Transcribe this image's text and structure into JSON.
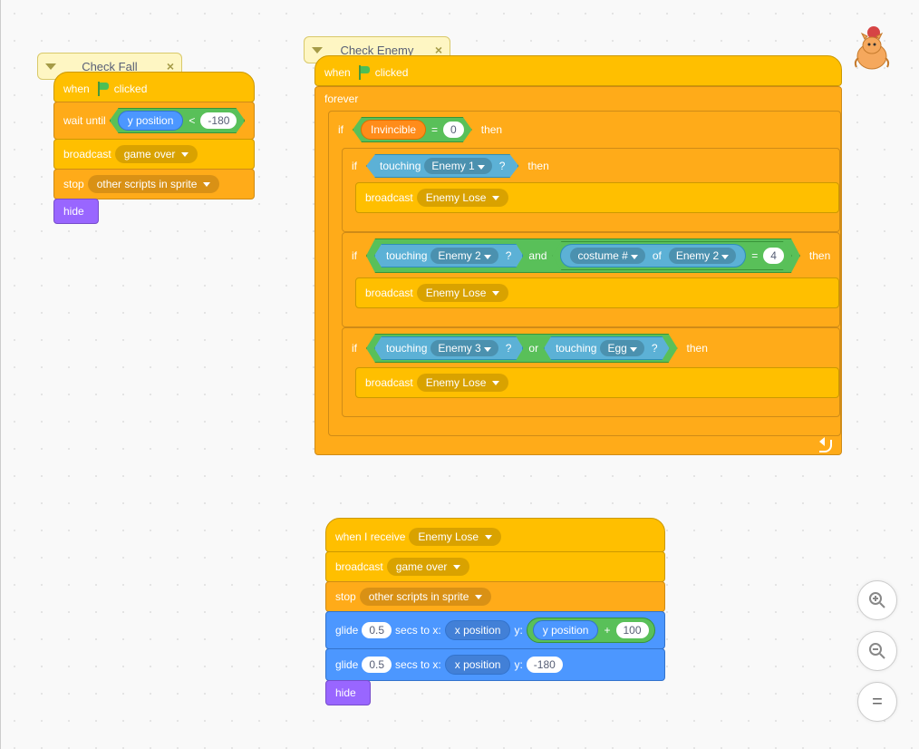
{
  "comments": {
    "checkFall": "Check Fall",
    "checkEnemy": "Check Enemy"
  },
  "common": {
    "when": "when",
    "clicked": "clicked",
    "waitUntil": "wait until",
    "broadcast": "broadcast",
    "stop": "stop",
    "hide": "hide",
    "forever": "forever",
    "if": "if",
    "then": "then",
    "and": "and",
    "or": "or",
    "of": "of",
    "touching": "touching",
    "whenIReceive": "when I receive",
    "glide": "glide",
    "secsToX": "secs to x:",
    "y": "y:",
    "lt": "<",
    "eq": "=",
    "plus": "+",
    "q": "?"
  },
  "fall": {
    "yposition": "y position",
    "ylimit": "-180",
    "gameOver": "game over",
    "otherScripts": "other scripts in sprite"
  },
  "enemy": {
    "invincible": "Invincible",
    "zero": "0",
    "enemy1": "Enemy 1",
    "enemy2": "Enemy 2",
    "enemy3": "Enemy 3",
    "egg": "Egg",
    "enemyLose": "Enemy Lose",
    "costumeNum": "costume #",
    "four": "4"
  },
  "lose": {
    "enemyLose": "Enemy Lose",
    "gameOver": "game over",
    "otherScripts": "other scripts in sprite",
    "glideSecs1": "0.5",
    "glideSecs2": "0.5",
    "xposition": "x position",
    "yposition": "y position",
    "hundred": "100",
    "minus180": "-180"
  },
  "zoom": {
    "in": "+",
    "out": "−",
    "reset": "="
  }
}
